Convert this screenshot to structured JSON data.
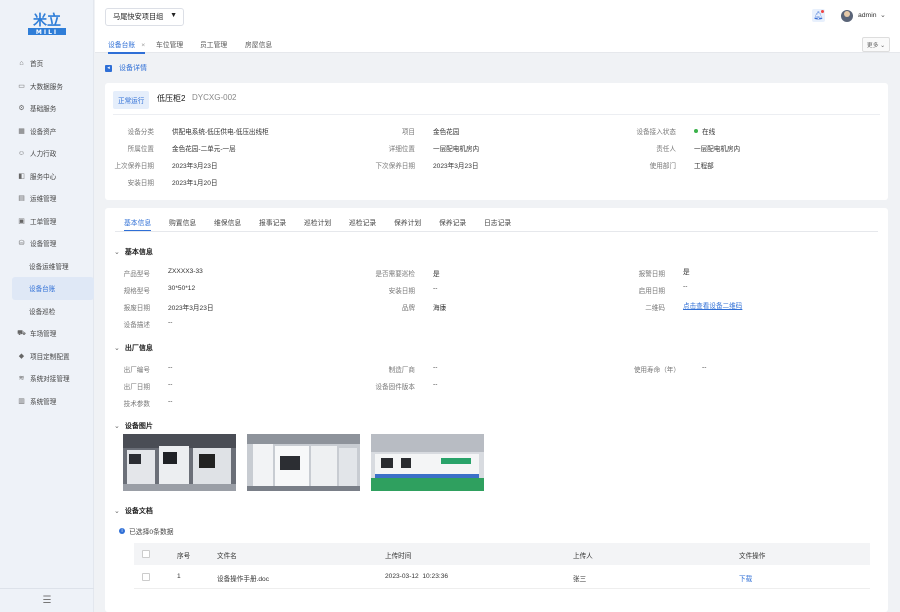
{
  "logo": {
    "text": "米立",
    "sub": "MILI"
  },
  "sidebar": {
    "items": [
      {
        "label": "首页",
        "icon": "home-icon"
      },
      {
        "label": "大数据服务",
        "icon": "monitor-icon"
      },
      {
        "label": "基础服务",
        "icon": "gear-icon"
      },
      {
        "label": "设备资产",
        "icon": "grid-icon"
      },
      {
        "label": "人力行政",
        "icon": "people-icon"
      },
      {
        "label": "服务中心",
        "icon": "service-icon"
      },
      {
        "label": "运维管理",
        "icon": "tool-icon"
      },
      {
        "label": "工单管理",
        "icon": "order-icon"
      },
      {
        "label": "设备管理",
        "icon": "device-icon"
      }
    ],
    "sub_items": [
      "设备运维管理",
      "设备台账",
      "设备巡检"
    ],
    "items2": [
      {
        "label": "车场管理",
        "icon": "car-icon"
      },
      {
        "label": "项目定制配置",
        "icon": "tag-icon"
      },
      {
        "label": "系统对接管理",
        "icon": "layers-icon"
      },
      {
        "label": "系统管理",
        "icon": "system-icon"
      }
    ]
  },
  "header": {
    "project": "马尾快安项目组",
    "user": "admin"
  },
  "page_tabs": [
    "设备台账",
    "车位管理",
    "员工管理",
    "房屋信息"
  ],
  "more_label": "更多",
  "breadcrumb": "设备详情",
  "device": {
    "status": "正常运行",
    "name": "低压柜2",
    "code": "DYCXG-002",
    "fields": [
      {
        "label": "设备分类",
        "value": "供配电系统-低压供电-低压出线柜"
      },
      {
        "label": "项目",
        "value": "金色花园"
      },
      {
        "label": "设备接入状态",
        "value": "在线"
      },
      {
        "label": "所属位置",
        "value": "金色花园-二单元-一层"
      },
      {
        "label": "详细位置",
        "value": "一层配电机房内"
      },
      {
        "label": "责任人",
        "value": "一层配电机房内"
      },
      {
        "label": "上次保养日期",
        "value": "2023年3月23日"
      },
      {
        "label": "下次保养日期",
        "value": "2023年3月23日"
      },
      {
        "label": "使用部门",
        "value": "工程部"
      },
      {
        "label": "安装日期",
        "value": "2023年1月20日"
      }
    ]
  },
  "detail_tabs": [
    "基本信息",
    "购置信息",
    "维保信息",
    "报事记录",
    "巡检计划",
    "巡检记录",
    "保养计划",
    "保养记录",
    "日志记录"
  ],
  "basic": {
    "title": "基本信息",
    "fields": [
      {
        "label": "产品型号",
        "value": "ZXXXX3-33"
      },
      {
        "label": "是否需要巡检",
        "value": "是"
      },
      {
        "label": "报警日期",
        "value": "是"
      },
      {
        "label": "规格型号",
        "value": "30*50*12"
      },
      {
        "label": "安装日期",
        "value": "--"
      },
      {
        "label": "启用日期",
        "value": "--"
      },
      {
        "label": "报废日期",
        "value": "2023年3月23日"
      },
      {
        "label": "品牌",
        "value": "海康"
      },
      {
        "label": "二维码",
        "value": "点击查看设备二维码"
      },
      {
        "label": "设备描述",
        "value": "--"
      }
    ]
  },
  "factory": {
    "title": "出厂信息",
    "fields": [
      {
        "label": "出厂编号",
        "value": "--"
      },
      {
        "label": "制造厂商",
        "value": "--"
      },
      {
        "label": "使用寿命（年）",
        "value": "--"
      },
      {
        "label": "出厂日期",
        "value": "--"
      },
      {
        "label": "设备固件版本",
        "value": "--"
      },
      {
        "label": "技术参数",
        "value": "--"
      }
    ]
  },
  "images": {
    "title": "设备图片"
  },
  "docs": {
    "title": "设备文档",
    "selected": "已选择0条数据",
    "headers": [
      "序号",
      "文件名",
      "上传时间",
      "上传人",
      "文件操作"
    ],
    "rows": [
      {
        "no": "1",
        "name": "设备操作手册.doc",
        "time": "2023-03-12  10:23:36",
        "uploader": "张三",
        "action": "下载"
      }
    ]
  },
  "colors": {
    "primary": "#2f6fd6",
    "online": "#3bb24a"
  }
}
